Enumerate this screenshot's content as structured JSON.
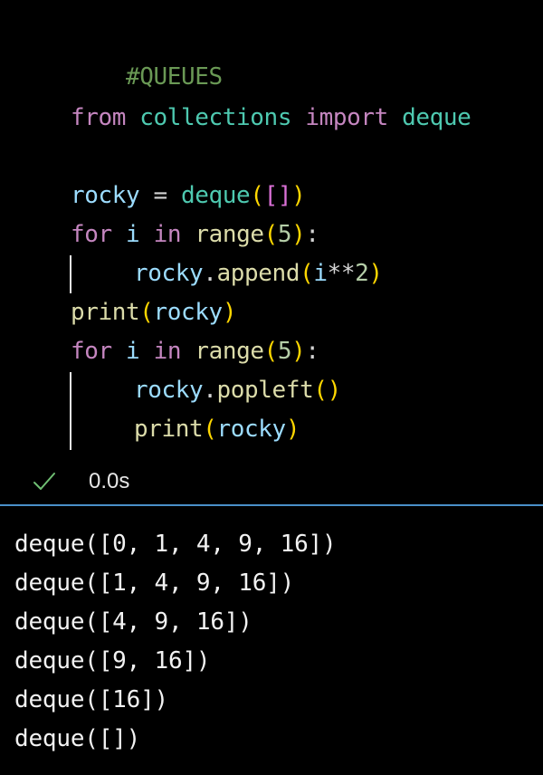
{
  "code": {
    "comment": "#QUEUES",
    "import_from": "from",
    "import_module": "collections",
    "import_kw": "import",
    "import_name": "deque",
    "line3": {
      "var": "rocky",
      "op": " = ",
      "fn": "deque",
      "open": "(",
      "lb": "[",
      "rb": "]",
      "close": ")"
    },
    "line4": {
      "kw": "for",
      "var": "i",
      "kw_in": "in",
      "fn": "range",
      "open": "(",
      "num": "5",
      "close": ")",
      "colon": ":"
    },
    "line5": {
      "var": "rocky",
      "dot": ".",
      "fn": "append",
      "open": "(",
      "arg": "i",
      "op": "**",
      "num": "2",
      "close": ")"
    },
    "line6": {
      "fn": "print",
      "open": "(",
      "var": "rocky",
      "close": ")"
    },
    "line7": {
      "kw": "for",
      "var": "i",
      "kw_in": "in",
      "fn": "range",
      "open": "(",
      "num": "5",
      "close": ")",
      "colon": ":"
    },
    "line8": {
      "var": "rocky",
      "dot": ".",
      "fn": "popleft",
      "open": "(",
      "close": ")"
    },
    "line9": {
      "fn": "print",
      "open": "(",
      "var": "rocky",
      "close": ")"
    }
  },
  "status": {
    "icon": "check-icon",
    "time": "0.0s"
  },
  "output": [
    "deque([0, 1, 4, 9, 16])",
    "deque([1, 4, 9, 16])",
    "deque([4, 9, 16])",
    "deque([9, 16])",
    "deque([16])",
    "deque([])"
  ],
  "colors": {
    "background": "#000000",
    "comment": "#6a9955",
    "keyword": "#c586c0",
    "module": "#4ec9b0",
    "variable": "#9cdcfe",
    "function": "#dcdcaa",
    "bracket_1": "#ffd700",
    "bracket_2": "#da70d6",
    "number": "#b5cea8",
    "divider": "#4a90c8",
    "check": "#6fbf73"
  }
}
